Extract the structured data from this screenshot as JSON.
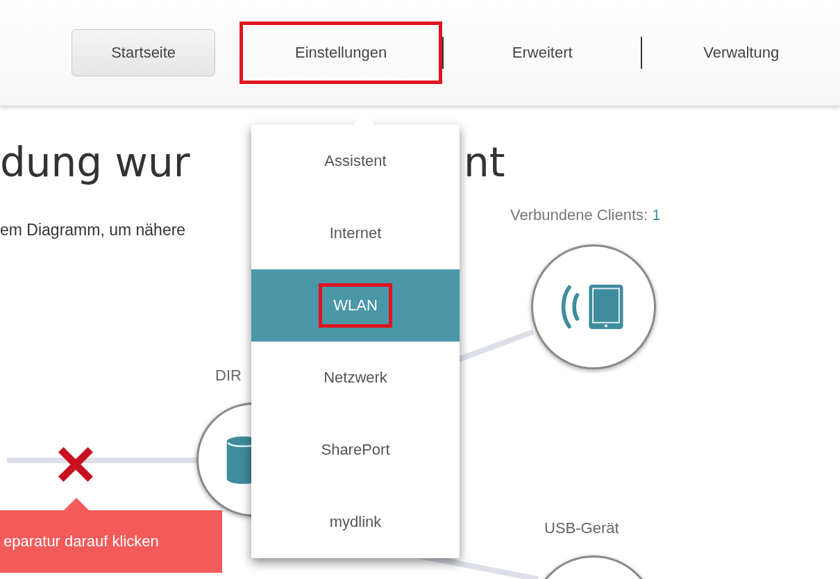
{
  "nav": {
    "tabs": [
      {
        "label": "Startseite",
        "selected": true,
        "highlighted": false
      },
      {
        "label": "Einstellungen",
        "selected": false,
        "highlighted": true
      },
      {
        "label": "Erweitert",
        "selected": false,
        "highlighted": false
      },
      {
        "label": "Verwaltung",
        "selected": false,
        "highlighted": false
      }
    ]
  },
  "heading": {
    "left": "dung wur",
    "right": "nt"
  },
  "subtitle": "em Diagramm, um nähere",
  "diagram": {
    "internet_link": {
      "error": true,
      "tooltip": "eparatur darauf klicken"
    },
    "router_label": "DIR",
    "clients_label": "Verbundene Clients:",
    "clients_count": "1",
    "usb_label": "USB-Gerät"
  },
  "menu": {
    "items": [
      {
        "label": "Assistent",
        "selected": false,
        "highlighted": false
      },
      {
        "label": "Internet",
        "selected": false,
        "highlighted": false
      },
      {
        "label": "WLAN",
        "selected": true,
        "highlighted": true
      },
      {
        "label": "Netzwerk",
        "selected": false,
        "highlighted": false
      },
      {
        "label": "SharePort",
        "selected": false,
        "highlighted": false
      },
      {
        "label": "mydlink",
        "selected": false,
        "highlighted": false
      }
    ]
  }
}
